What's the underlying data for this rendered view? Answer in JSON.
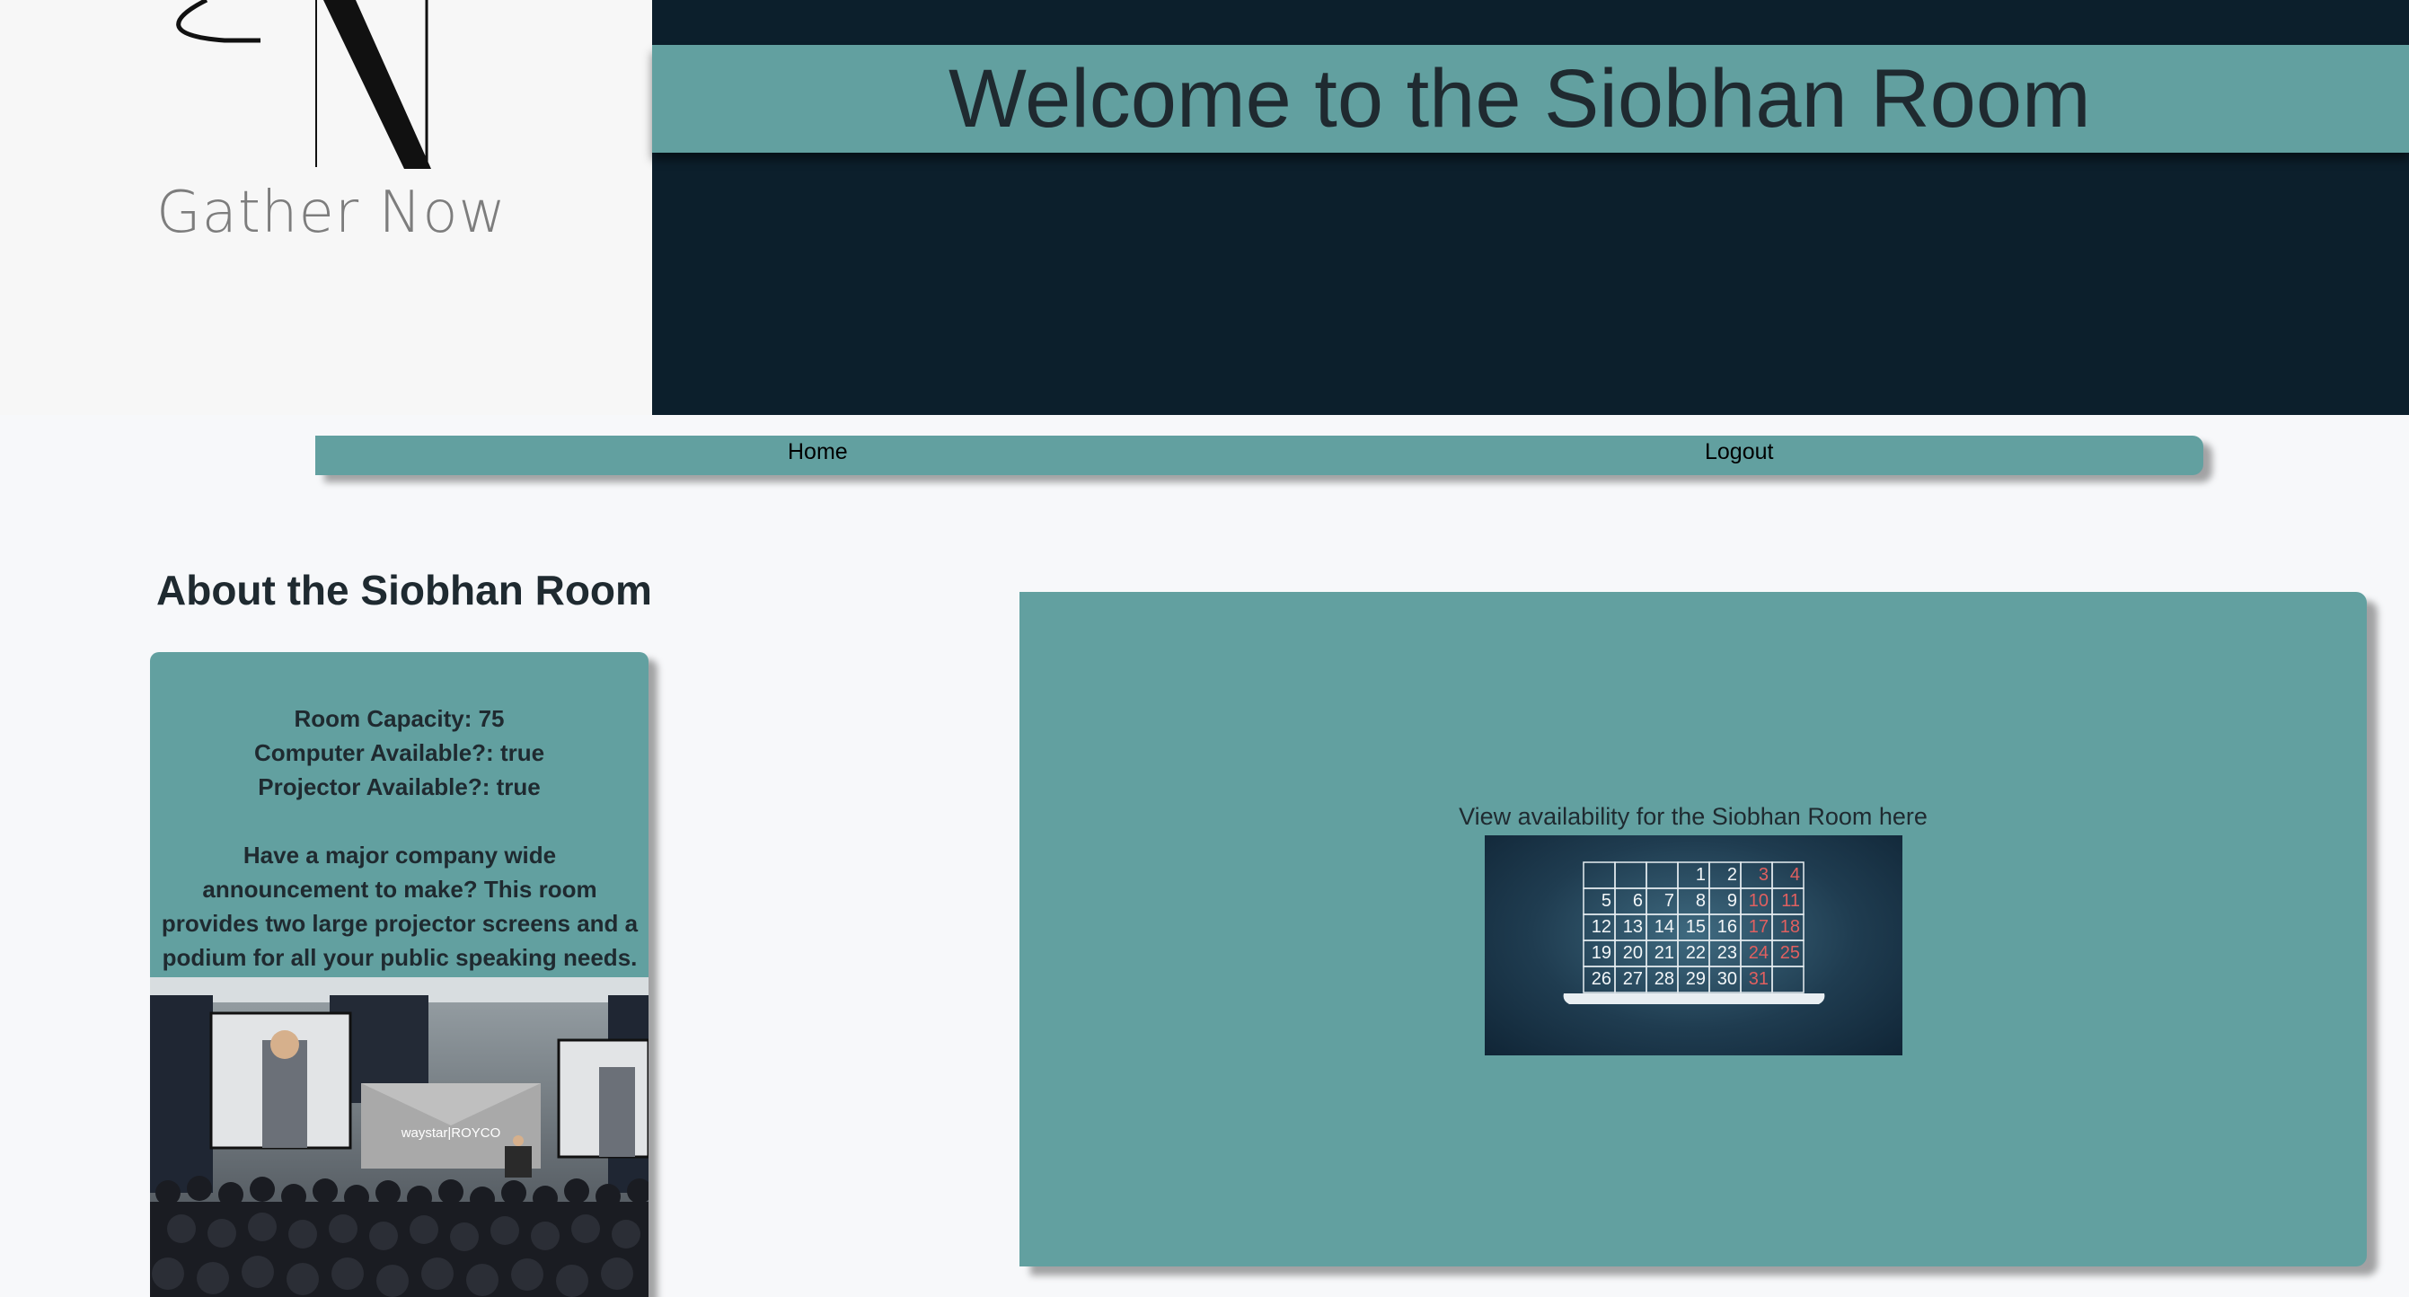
{
  "logo": {
    "icon": "gather-now-monogram-icon",
    "text": "Gather Now"
  },
  "hero": {
    "title": "Welcome to the Siobhan Room"
  },
  "nav": {
    "home_label": "Home",
    "logout_label": "Logout"
  },
  "about": {
    "heading": "About the Siobhan Room",
    "capacity": "Room Capacity: 75",
    "computer": "Computer Available?: true",
    "projector": "Projector Available?: true",
    "description": "Have a major company wide announcement to make? This room provides two large projector screens and a podium for all your public speaking needs.",
    "photo_icon": "conference-room-photo",
    "photo_text": "waystar|ROYCO"
  },
  "availability": {
    "link_text": "View availability for the Siobhan Room here",
    "calendar_icon": "calendar-tablet-icon",
    "calendar_rows": [
      [
        "",
        "",
        "",
        "1",
        "2",
        "3",
        "4"
      ],
      [
        "5",
        "6",
        "7",
        "8",
        "9",
        "10",
        "11"
      ],
      [
        "12",
        "13",
        "14",
        "15",
        "16",
        "17",
        "18"
      ],
      [
        "19",
        "20",
        "21",
        "22",
        "23",
        "24",
        "25"
      ],
      [
        "26",
        "27",
        "28",
        "29",
        "30",
        "31",
        ""
      ]
    ]
  },
  "colors": {
    "teal": "#62a0a0",
    "navy": "#0c1f2c",
    "weekend_red": "#e06060"
  }
}
